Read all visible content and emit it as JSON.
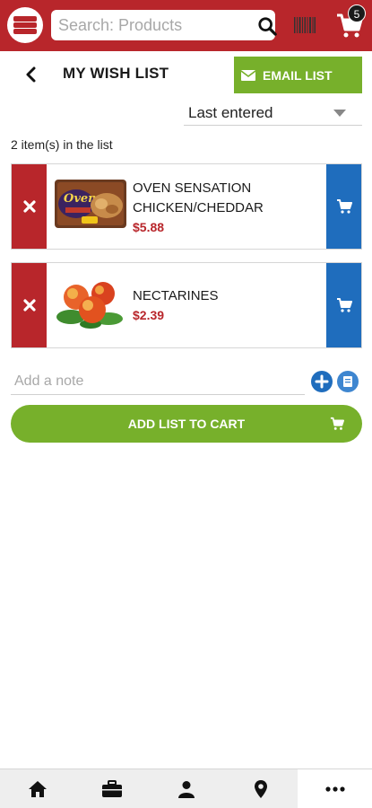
{
  "header": {
    "logo_icon": "store-logo-icon",
    "search_placeholder": "Search: Products",
    "search_icon": "search-icon",
    "barcode_icon": "barcode-icon",
    "cart_icon": "cart-icon",
    "cart_count": "5",
    "brand_color": "#b8262b"
  },
  "title_bar": {
    "back_icon": "chevron-left-icon",
    "title": "MY WISH LIST",
    "email_label": "EMAIL LIST",
    "email_icon": "envelope-icon",
    "accent_color": "#77b02b"
  },
  "sort": {
    "selected": "Last entered"
  },
  "list": {
    "count_text": "2 item(s) in the list",
    "items": [
      {
        "name_line1": "OVEN SENSATION",
        "name_line2": "CHICKEN/CHEDDAR",
        "price": "$5.88",
        "image": "oven-sensation-package-image"
      },
      {
        "name_line1": "NECTARINES",
        "name_line2": "",
        "price": "$2.39",
        "image": "nectarines-image"
      }
    ]
  },
  "note": {
    "placeholder": "Add a note"
  },
  "add_list": {
    "label": "ADD LIST TO CART"
  },
  "bottom_nav": {
    "items": [
      "home-icon",
      "briefcase-icon",
      "user-icon",
      "location-pin-icon",
      "more-icon"
    ],
    "active": "more-icon"
  }
}
